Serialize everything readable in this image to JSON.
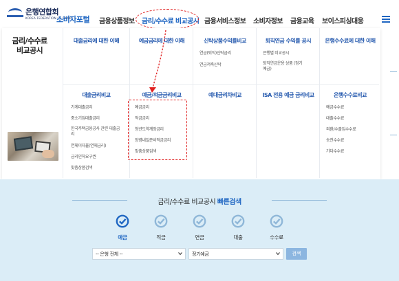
{
  "header": {
    "logo_ko": "은행연합회",
    "logo_en": "KOREA FEDERATION OF BANKS",
    "portal": "소비자포털",
    "nav": [
      "금융상품정보",
      "금리/수수료 비교공시",
      "금융서비스정보",
      "소비자정보",
      "금융교육",
      "보이스피싱대응"
    ],
    "active_nav_index": 1
  },
  "mega": {
    "title": "금리/수수료 비교공시",
    "top_columns": [
      {
        "heading": "대출금리에 대한 이해",
        "items": []
      },
      {
        "heading": "예금금리에 대한 이해",
        "items": []
      },
      {
        "heading": "신탁상품수익률비교",
        "items": [
          "연금(퇴직)신탁금리",
          "연금저축신탁"
        ]
      },
      {
        "heading": "퇴직연금 수익률 공시",
        "items": [
          "은행별 비교공시",
          "퇴직연금운용 상품 (정기예금)"
        ]
      },
      {
        "heading": "은행수수료에 대한 이해",
        "items": []
      }
    ],
    "bottom_columns": [
      {
        "heading": "대출금리비교",
        "items": [
          "가계대출금리",
          "중소기업대출금리",
          "한국주택금융공사 관련 대출금리",
          "연체이자율(연체금리)",
          "금리인하요구권",
          "맞춤상품검색"
        ]
      },
      {
        "heading": "예금/적금금리비교",
        "items": [
          "예금금리",
          "적금금리",
          "청년도약계좌금리",
          "장병내일준비적금금리",
          "맞춤상품검색"
        ]
      },
      {
        "heading": "예대금리차비교",
        "items": []
      },
      {
        "heading": "ISA 전용 예금 금리비교",
        "items": []
      },
      {
        "heading": "은행수수료비교",
        "items": [
          "예금수수료",
          "대출수수료",
          "외환/수출입수수료",
          "송전수수료",
          "기타수수료"
        ]
      }
    ]
  },
  "quick_search": {
    "title_main": "금리/수수료 비교공시",
    "title_bold": "빠른검색",
    "options": [
      {
        "label": "예금",
        "selected": true
      },
      {
        "label": "적금",
        "selected": false
      },
      {
        "label": "연금",
        "selected": false
      },
      {
        "label": "대출",
        "selected": false
      },
      {
        "label": "수수료",
        "selected": false
      }
    ],
    "bank_select": "-- 은행 전체 --",
    "product_select": "정기예금",
    "search_button": "검색"
  },
  "colors": {
    "brand": "#1f66c2",
    "highlight": "#e02020",
    "check_selected": "#1f66c2",
    "check_unselected": "#8fb7d8",
    "lower_bg": "#dbedf7"
  }
}
